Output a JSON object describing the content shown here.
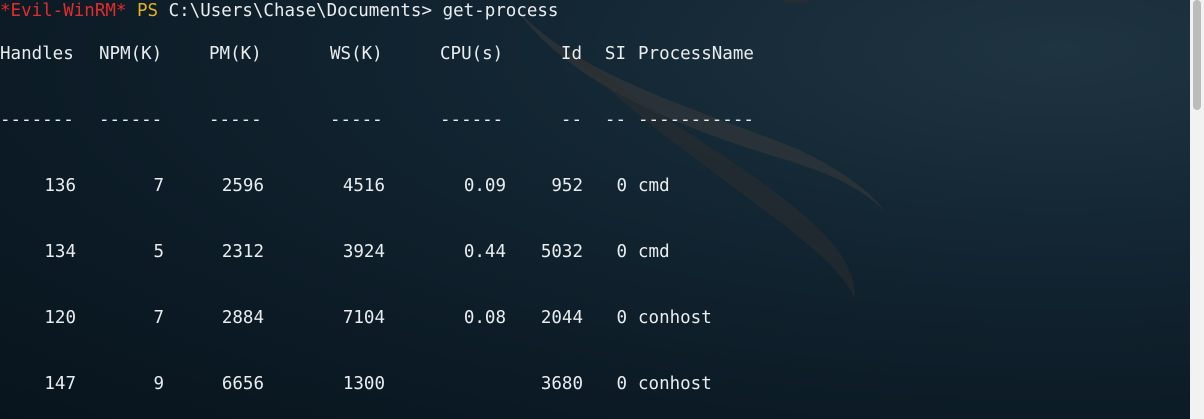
{
  "prompt": {
    "tag": "*Evil-WinRM*",
    "shell": "PS",
    "path": "C:\\Users\\Chase\\Documents>",
    "command": "get-process"
  },
  "table": {
    "headers": [
      "Handles",
      "NPM(K)",
      "PM(K)",
      "WS(K)",
      "CPU(s)",
      "Id",
      "SI",
      "ProcessName"
    ],
    "separators": [
      "-------",
      "------",
      "-----",
      "-----",
      "------",
      "--",
      "--",
      "-----------"
    ],
    "rows": [
      [
        "136",
        "7",
        "2596",
        "4516",
        "0.09",
        "952",
        "0",
        "cmd"
      ],
      [
        "134",
        "5",
        "2312",
        "3924",
        "0.44",
        "5032",
        "0",
        "cmd"
      ],
      [
        "120",
        "7",
        "2884",
        "7104",
        "0.08",
        "2044",
        "0",
        "conhost"
      ],
      [
        "147",
        "9",
        "6656",
        "1300",
        "",
        "3680",
        "0",
        "conhost"
      ]
    ]
  },
  "colors": {
    "prompt_tag": "#e32b2b",
    "prompt_ps": "#e3b21f",
    "text": "#e9edef",
    "background": "#0c1b26"
  },
  "icons": {
    "background_logo": "kali-dragon-logo"
  }
}
